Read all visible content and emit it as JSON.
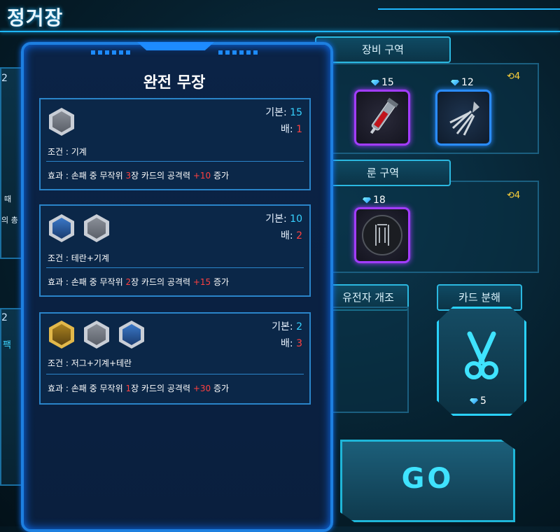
{
  "header": {
    "title": "정거장"
  },
  "background": {
    "left_card_top_count": "2",
    "left_card_text_lines": [
      "때",
      "의 총"
    ],
    "left_card_mid_count": "2",
    "left_card_mid_label": "팩"
  },
  "equipment_zone": {
    "label": "장비 구역",
    "refresh_count": "4",
    "items": [
      {
        "cost": "15",
        "icon": "syringe-icon",
        "rarity_color": "#a23cff"
      },
      {
        "cost": "12",
        "icon": "claw-icon",
        "rarity_color": "#2a8cff"
      }
    ]
  },
  "rune_zone": {
    "label": "룬 구역",
    "refresh_count": "4",
    "items": [
      {
        "cost": "18",
        "icon": "rune-emblem-icon",
        "rarity_color": "#a23cff"
      }
    ]
  },
  "gene_mod": {
    "label": "유전자 개조"
  },
  "card_dismantle": {
    "label": "카드 분해",
    "cost": "5",
    "icon": "scissors-icon"
  },
  "go_button": {
    "label": "GO"
  },
  "modal": {
    "title": "완전 무장",
    "tiers": [
      {
        "base_label": "기본: ",
        "base_value": "15",
        "mult_label": "배: ",
        "mult_value": "1",
        "condition": "조건 : 기계",
        "effect_prefix": "효과 : 손패 중 무작위 ",
        "effect_count": "3",
        "effect_middle": "장 카드의 공격력 ",
        "effect_bonus": "+10",
        "effect_suffix": " 증가",
        "hexes": [
          "gray"
        ]
      },
      {
        "base_label": "기본: ",
        "base_value": "10",
        "mult_label": "배: ",
        "mult_value": "2",
        "condition": "조건 : 테란+기계",
        "effect_prefix": "효과 : 손패 중 무작위 ",
        "effect_count": "2",
        "effect_middle": "장 카드의 공격력 ",
        "effect_bonus": "+15",
        "effect_suffix": " 증가",
        "hexes": [
          "blue",
          "gray"
        ]
      },
      {
        "base_label": "기본: ",
        "base_value": "2",
        "mult_label": "배: ",
        "mult_value": "3",
        "condition": "조건 : 저그+기계+테란",
        "effect_prefix": "효과 : 손패 중 무작위 ",
        "effect_count": "1",
        "effect_middle": "장 카드의 공격력 ",
        "effect_bonus": "+30",
        "effect_suffix": " 증가",
        "hexes": [
          "gold",
          "gray",
          "blue"
        ]
      }
    ]
  },
  "colors": {
    "accent": "#1fb8ff",
    "modal_border": "#1d7fe0",
    "highlight_red": "#ff4040",
    "value_cyan": "#37d2ff"
  }
}
